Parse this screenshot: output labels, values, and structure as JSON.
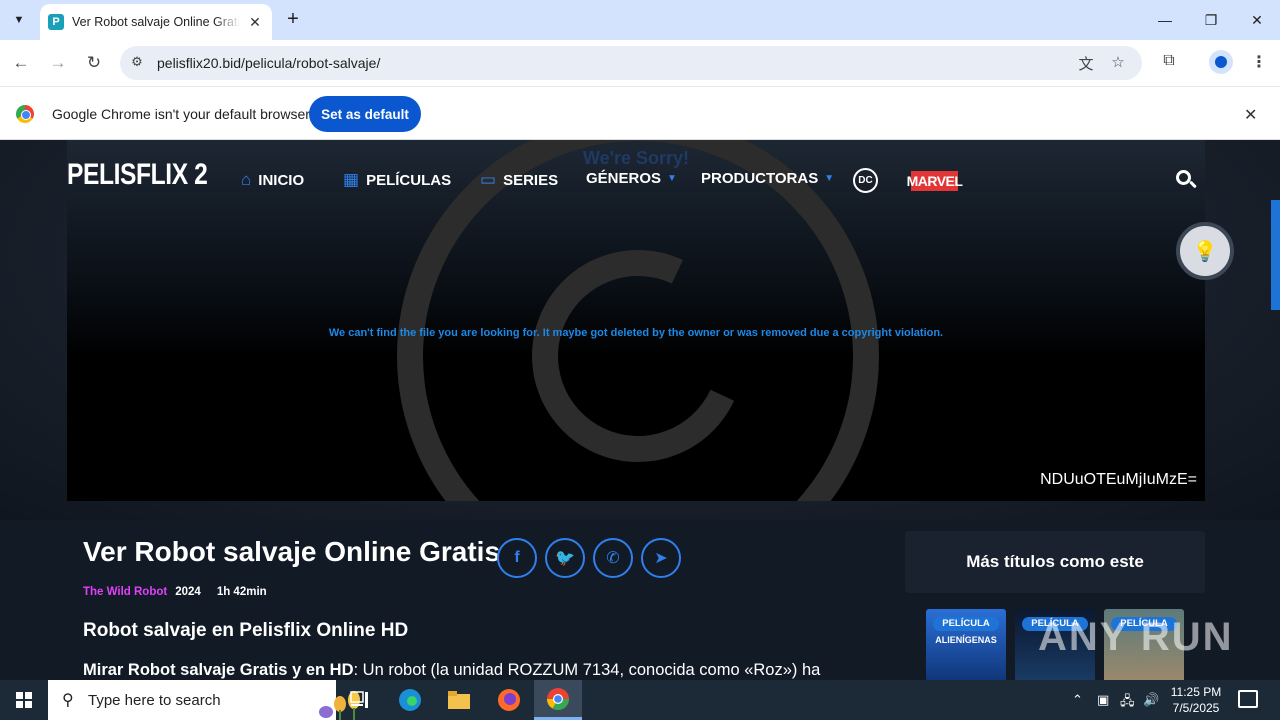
{
  "browser": {
    "tab": {
      "title": "Ver Robot salvaje Online Gratis",
      "favicon_letter": "P"
    },
    "new_tab": "+",
    "url": "pelisflix20.bid/pelicula/robot-salvaje/",
    "window_controls": {
      "minimize": "—",
      "maximize": "❐",
      "close": "✕"
    }
  },
  "infobar": {
    "message": "Google Chrome isn't your default browser",
    "button": "Set as default",
    "close": "✕"
  },
  "site": {
    "logo": "PELISFLIX 2",
    "nav": [
      {
        "label": "INICIO",
        "icon": "home-icon"
      },
      {
        "label": "PELÍCULAS",
        "icon": "film-icon"
      },
      {
        "label": "SERIES",
        "icon": "tv-icon"
      },
      {
        "label": "GÉNEROS",
        "icon": "caret-down-icon"
      },
      {
        "label": "PRODUCTORAS",
        "icon": "caret-down-icon"
      }
    ],
    "dc_label": "DC",
    "marvel_label": "MARVEL"
  },
  "player": {
    "sorry": "We're Sorry!",
    "message": "We can't find the file you are looking for. It maybe got deleted by the owner or was removed due a copyright violation.",
    "code": "NDUuOTEuMjIuMzE="
  },
  "movie": {
    "title": "Ver Robot salvaje Online Gratis",
    "original_title": "The Wild Robot",
    "year": "2024",
    "duration": "1h 42min",
    "subtitle": "Robot salvaje en Pelisflix Online HD",
    "desc_bold": "Mirar Robot salvaje Gratis y en HD",
    "desc_rest": ": Un robot (la unidad ROZZUM 7134, conocida como «Roz») ha"
  },
  "sidebar": {
    "title": "Más títulos como este",
    "posters": [
      {
        "badge": "PELÍCULA",
        "text": "ALIENÍGENAS"
      },
      {
        "badge": "PELÍCULA",
        "text": ""
      },
      {
        "badge": "PELÍCULA",
        "text": ""
      }
    ]
  },
  "watermark": "ANY RUN",
  "taskbar": {
    "search_placeholder": "Type here to search",
    "time": "11:25 PM",
    "date": "7/5/2025"
  },
  "colors": {
    "accent": "#2f80ed",
    "chrome_blue": "#0b57d0",
    "original_title": "#e040fb"
  }
}
